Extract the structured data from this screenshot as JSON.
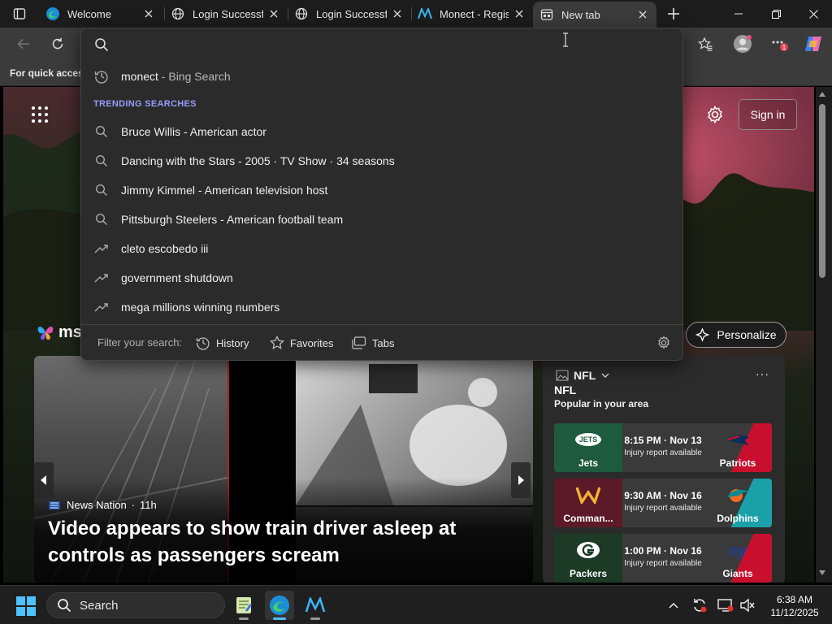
{
  "tabs": [
    {
      "title": "Welcome",
      "icon": "edge-icon"
    },
    {
      "title": "Login Successful",
      "icon": "globe-icon"
    },
    {
      "title": "Login Successful",
      "icon": "globe-icon"
    },
    {
      "title": "Monect - Registe",
      "icon": "monect-icon"
    },
    {
      "title": "New tab",
      "icon": "newtab-icon",
      "active": true
    }
  ],
  "favorites_bar": {
    "text": "For quick access"
  },
  "omnibox": {
    "value": "",
    "history_item": {
      "main": "monect",
      "secondary": " - Bing Search"
    },
    "trending_label": "TRENDING SEARCHES",
    "suggestions": [
      {
        "main": "Bruce Willis",
        "secondary": " - American actor",
        "icon": "search"
      },
      {
        "main": "Dancing with the Stars",
        "secondary": " - 2005 · TV Show · 34 seasons",
        "icon": "search"
      },
      {
        "main": "Jimmy Kimmel",
        "secondary": " - American television host",
        "icon": "search"
      },
      {
        "main": "Pittsburgh Steelers",
        "secondary": " - American football team",
        "icon": "search"
      },
      {
        "main": "cleto escobedo iii",
        "secondary": "",
        "icon": "trend"
      },
      {
        "main": "government shutdown",
        "secondary": "",
        "icon": "trend"
      },
      {
        "main": "mega millions winning numbers",
        "secondary": "",
        "icon": "trend"
      }
    ],
    "filter_label": "Filter your search:",
    "filters": [
      "History",
      "Favorites",
      "Tabs"
    ]
  },
  "page": {
    "sign_in": "Sign in",
    "msn_text": "msn",
    "personalize": "Personalize",
    "hero": {
      "source": "News Nation",
      "age": "11h",
      "title": "Video appears to show train driver asleep at controls as passengers scream"
    },
    "nfl": {
      "header": "NFL",
      "league": "NFL",
      "subtitle": "Popular in your area",
      "more": "···",
      "games": [
        {
          "home": "Jets",
          "away": "Patriots",
          "time": "8:15 PM · Nov 13",
          "note": "Injury report available",
          "home_color": "#1e5b3e",
          "away_color": "#c8102e"
        },
        {
          "home": "Comman...",
          "away": "Dolphins",
          "time": "9:30 AM · Nov 16",
          "note": "Injury report available",
          "home_color": "#6a1b2a",
          "away_color": "#1aa0a8"
        },
        {
          "home": "Packers",
          "away": "Giants",
          "time": "1:00 PM · Nov 16",
          "note": "Injury report available",
          "home_color": "#1c3a26",
          "away_color": "#c8102e"
        }
      ]
    }
  },
  "taskbar": {
    "search_label": "Search",
    "time": "6:38 AM",
    "date": "11/12/2025"
  },
  "colors": {
    "accent": "#4cc2ff",
    "trending": "#9a9aff",
    "omnibox_bg": "#2b2b2b"
  }
}
